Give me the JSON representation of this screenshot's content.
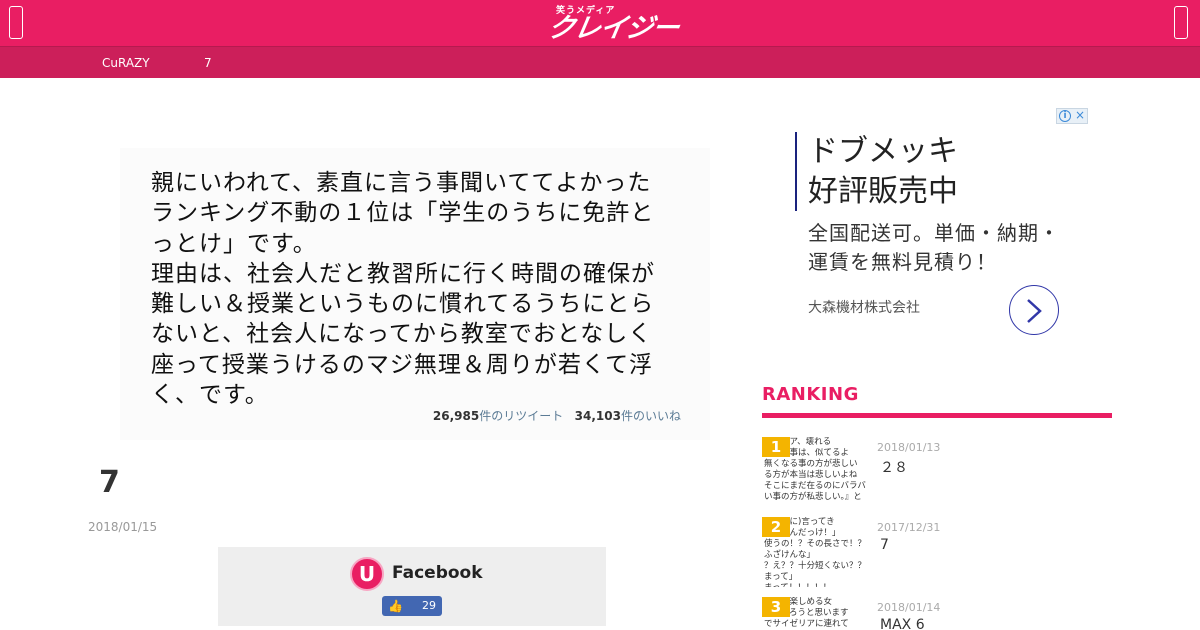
{
  "header": {
    "logo_small": "笑うメディア",
    "logo_main": "クレイジー",
    "breadcrumb": [
      "CuRAZY",
      "7"
    ]
  },
  "tweet": {
    "text": "親にいわれて、素直に言う事聞いててよかった\nランキング不動の１位は「学生のうちに免許と\nっとけ」です。\n理由は、社会人だと教習所に行く時間の確保が\n難しい＆授業というものに慣れてるうちにとら\nないと、社会人になってから教室でおとなしく\n座って授業うけるのマジ無理＆周りが若くて浮\nく、です。",
    "retweets": "26,985",
    "retweets_label": "件のリツイート",
    "likes": "34,103",
    "likes_label": "件のいいね"
  },
  "article": {
    "title": "7",
    "date": "2018/01/15"
  },
  "facebook": {
    "logo_letter": "U",
    "title": "Facebook",
    "like_count": "29"
  },
  "ad": {
    "headline": "ドブメッキ\n好評販売中",
    "body": "全国配送可。単価・納期・\n運賃を無料見積り！",
    "company": "大森機材株式会社"
  },
  "ranking": {
    "title": "RANKING",
    "items": [
      {
        "rank": "1",
        "date": "2018/01/13",
        "text": "２８",
        "thumb_text": "『ママア、壊れる\nという事は、似てるよ\n無くなる事の方が悲しい\nる方が本当は悲しいよね\nそこにまだ在るのにバラバ\nい事の方が私悲しい。』と"
      },
      {
        "rank": "2",
        "date": "2017/12/31",
        "text": "7",
        "thumb_text": "るように)言ってき\nなったんだっけ！」\n使うの！？その長さで！？\nふざけんな」\n？え？？十分短くない？？\nまって」\nまって！！！！！"
      },
      {
        "rank": "3",
        "date": "2018/01/14",
        "text": "MAX 6",
        "thumb_text": "リアを楽しめる女\n幸せだろうと思います\nでサイゼリアに連れて"
      }
    ]
  },
  "colors": {
    "brand": "#e91e63",
    "subbar": "#cc1f5a",
    "rank_badge": "#f4b400",
    "fb_blue": "#4267b2"
  }
}
